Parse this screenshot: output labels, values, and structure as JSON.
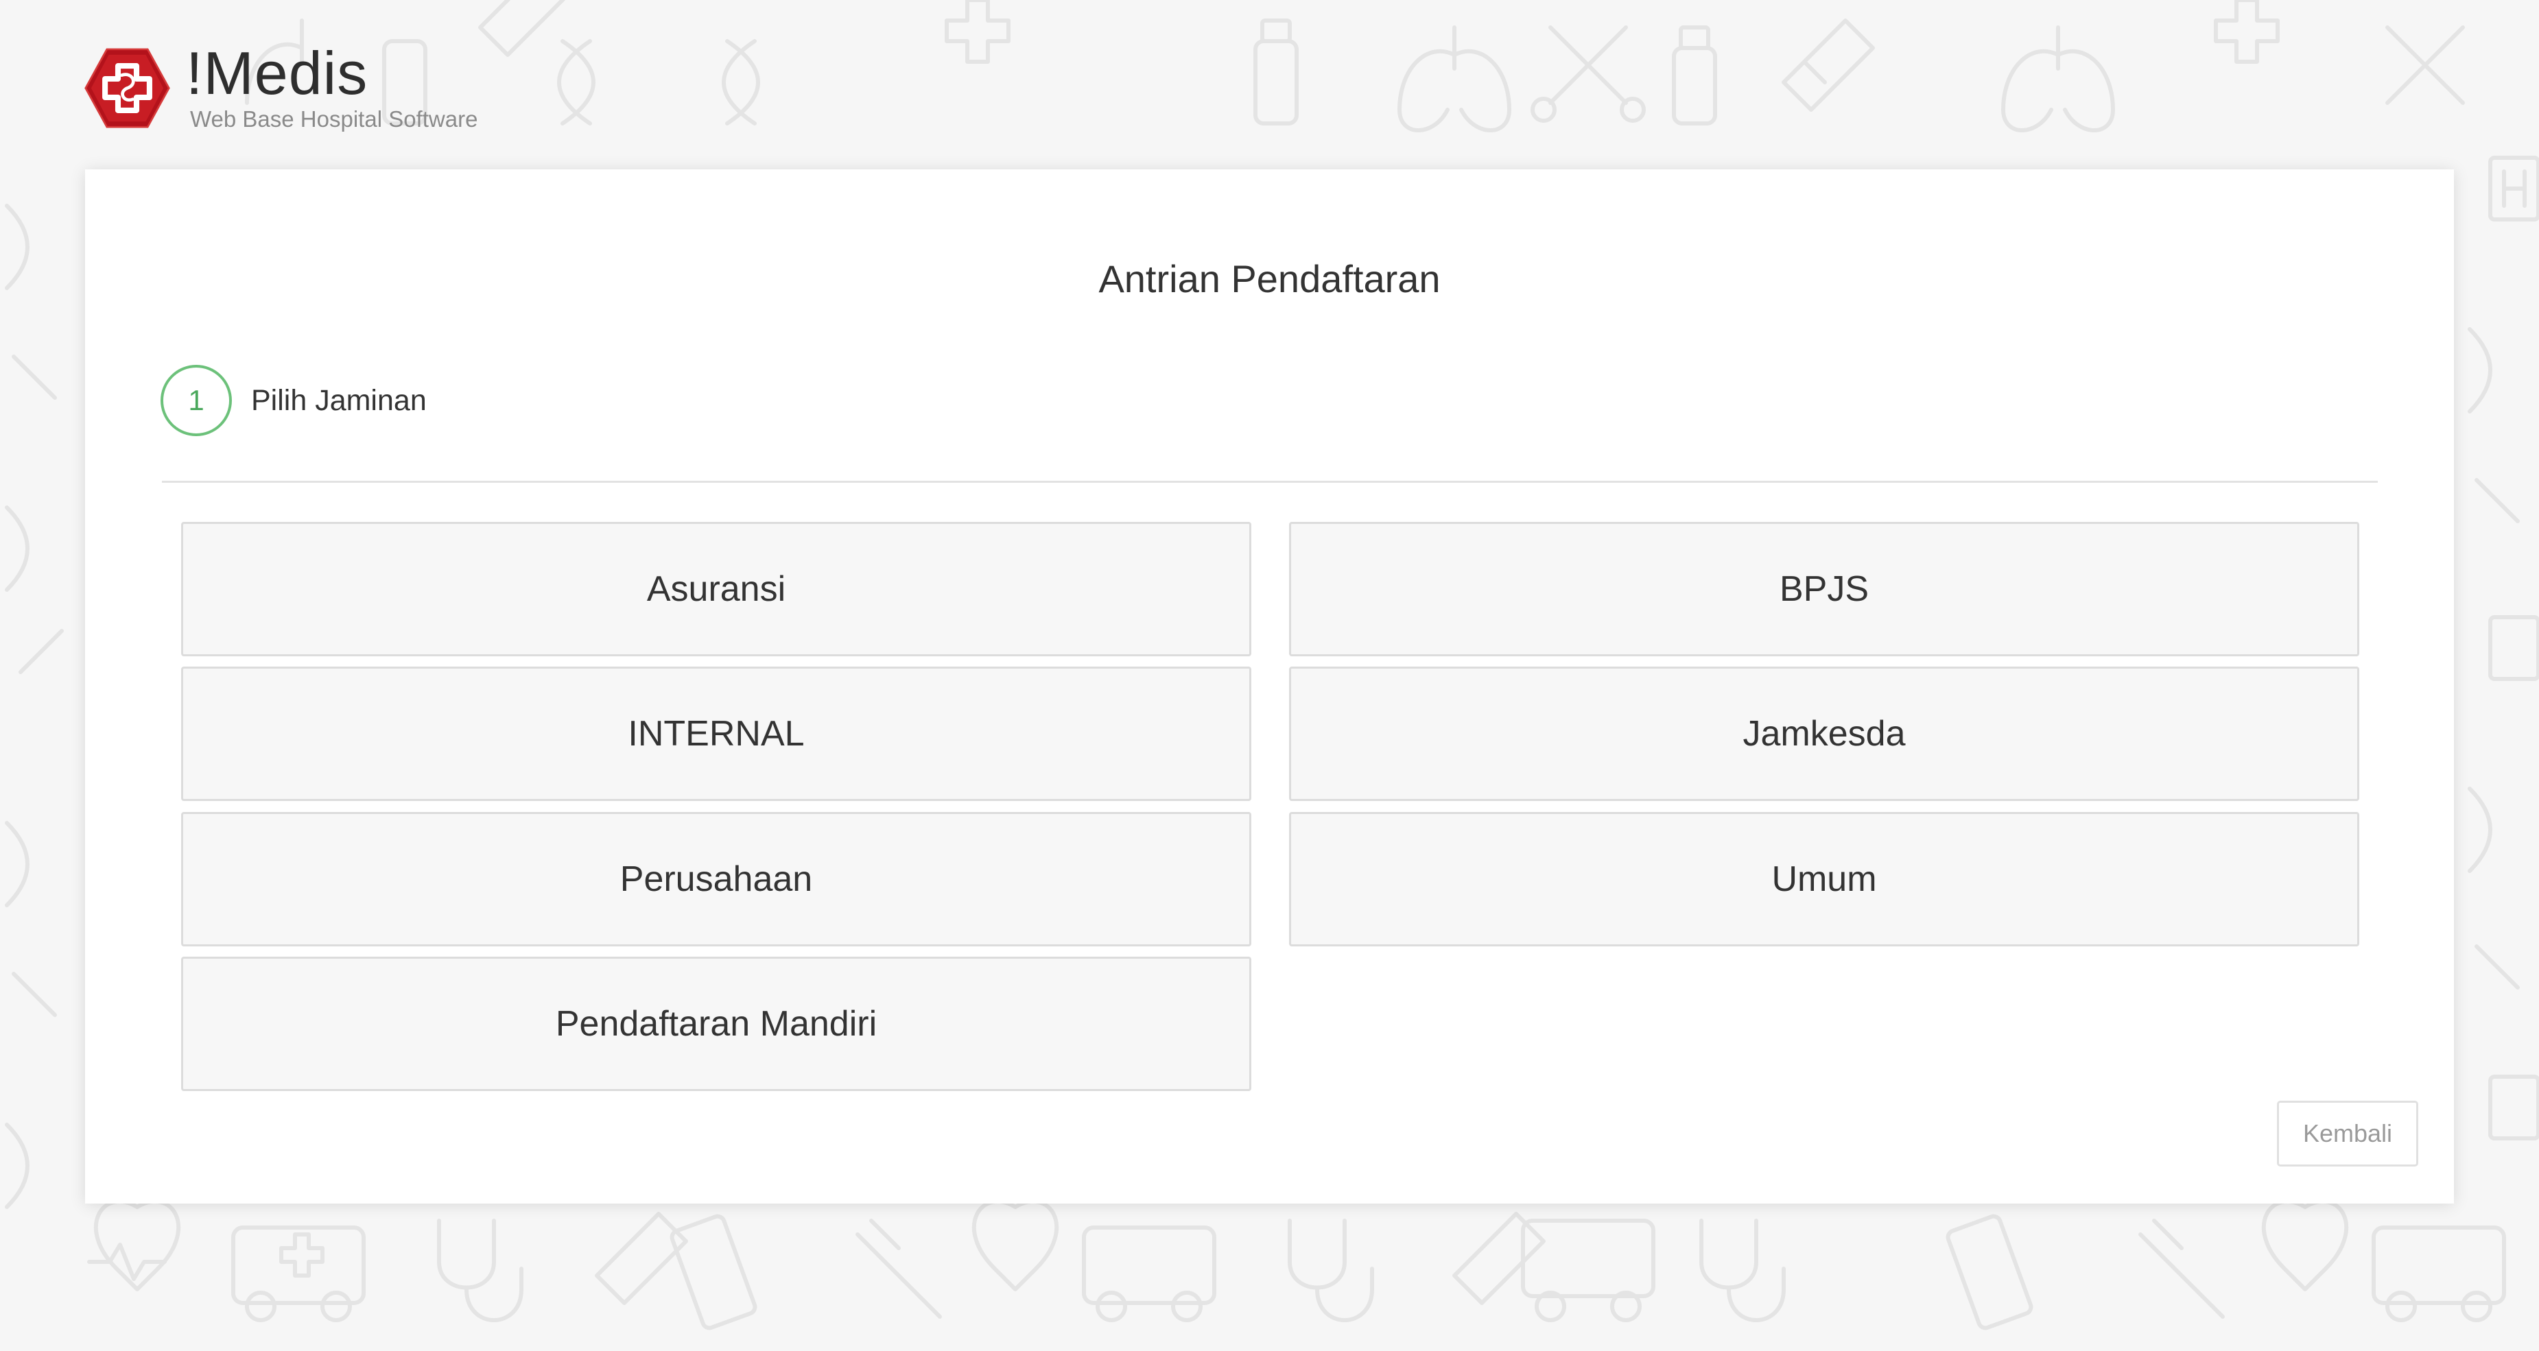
{
  "brand": {
    "name": "!Medis",
    "tagline": "Web Base Hospital Software",
    "logo_icon": "red-hexagon-medical-cross-icon",
    "brand_color": "#b3121b"
  },
  "panel": {
    "title": "Antrian Pendaftaran"
  },
  "step": {
    "number": "1",
    "label": "Pilih Jaminan",
    "accent_color": "#6cc17a"
  },
  "options": [
    {
      "label": "Asuransi"
    },
    {
      "label": "BPJS"
    },
    {
      "label": "INTERNAL"
    },
    {
      "label": "Jamkesda"
    },
    {
      "label": "Perusahaan"
    },
    {
      "label": "Umum"
    },
    {
      "label": "Pendaftaran Mandiri"
    }
  ],
  "actions": {
    "back_label": "Kembali"
  },
  "background": {
    "pattern_icons": [
      "medical-cross-icon",
      "bandage-icon",
      "medicine-bottle-icon",
      "lungs-icon",
      "dna-icon",
      "tooth-icon",
      "scissors-icon",
      "ambulance-icon",
      "stethoscope-icon",
      "heart-pulse-icon",
      "syringe-icon",
      "pill-pack-icon",
      "hospital-sign-icon"
    ]
  }
}
